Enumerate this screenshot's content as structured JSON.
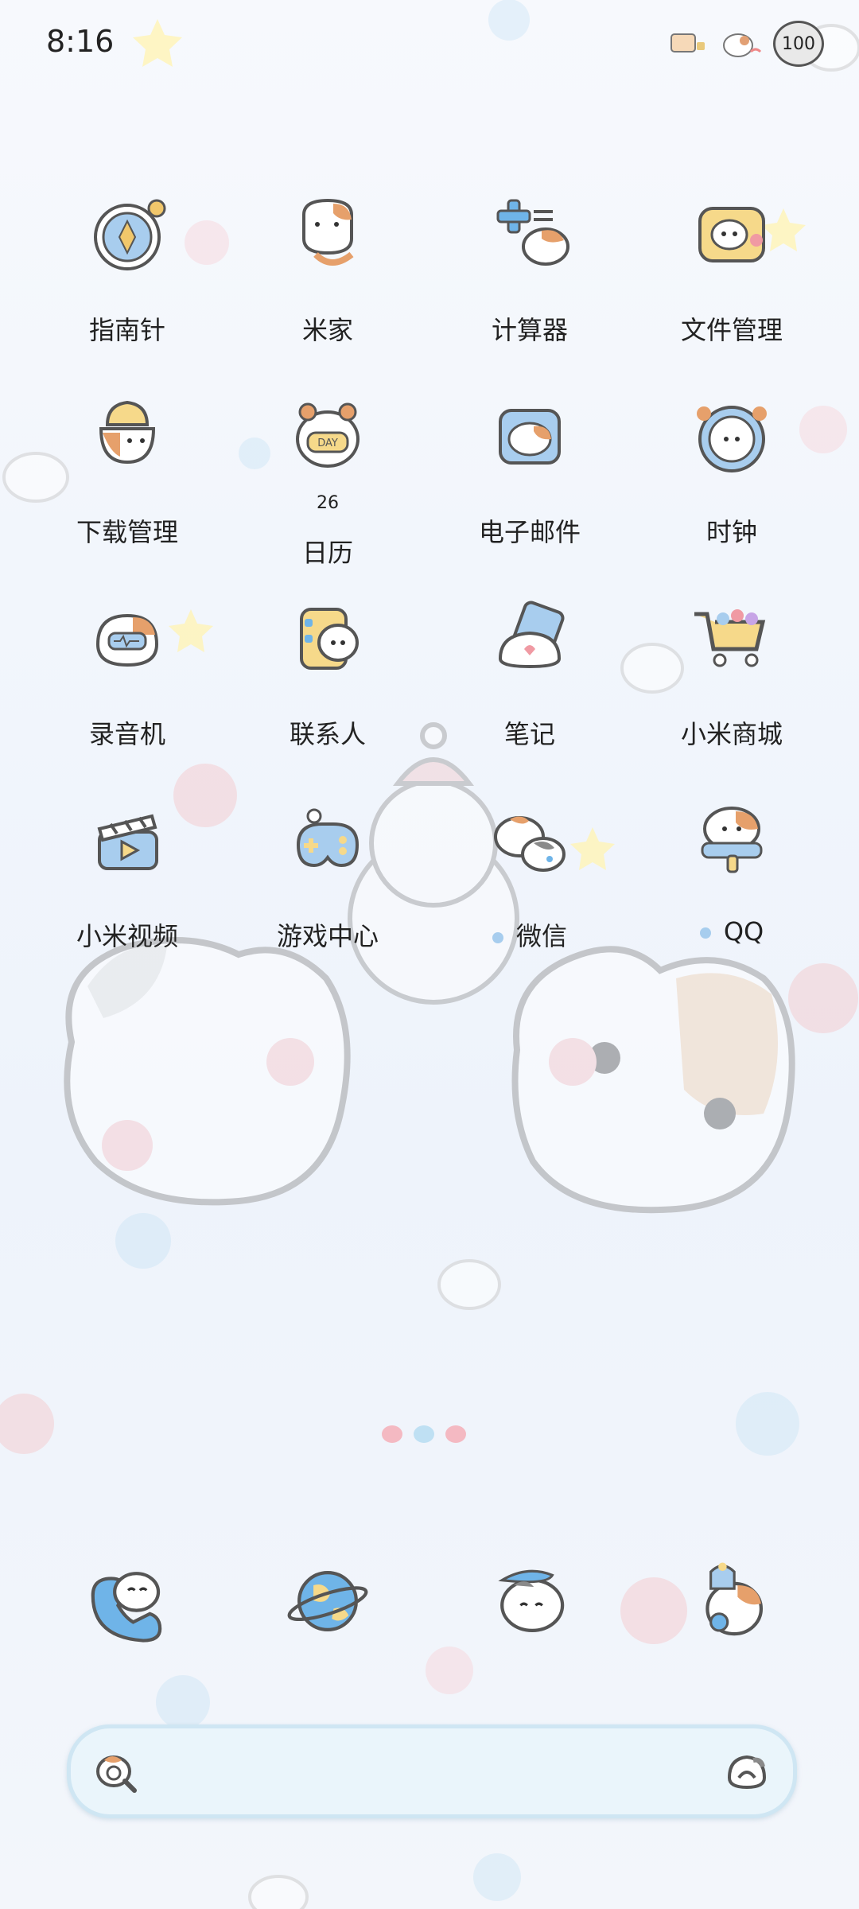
{
  "status_bar": {
    "time": "8:16",
    "battery": "100"
  },
  "apps": [
    [
      {
        "label": "指南针",
        "icon": "compass-icon"
      },
      {
        "label": "米家",
        "icon": "mihome-icon"
      },
      {
        "label": "计算器",
        "icon": "calculator-icon"
      },
      {
        "label": "文件管理",
        "icon": "file-manager-icon"
      }
    ],
    [
      {
        "label": "下载管理",
        "icon": "download-icon"
      },
      {
        "label": "日历",
        "icon": "calendar-icon",
        "date": "26"
      },
      {
        "label": "电子邮件",
        "icon": "email-icon"
      },
      {
        "label": "时钟",
        "icon": "clock-icon"
      }
    ],
    [
      {
        "label": "录音机",
        "icon": "recorder-icon"
      },
      {
        "label": "联系人",
        "icon": "contacts-icon"
      },
      {
        "label": "笔记",
        "icon": "notes-icon"
      },
      {
        "label": "小米商城",
        "icon": "mi-store-icon"
      }
    ],
    [
      {
        "label": "小米视频",
        "icon": "video-icon"
      },
      {
        "label": "游戏中心",
        "icon": "game-center-icon"
      },
      {
        "label": "微信",
        "icon": "wechat-icon"
      },
      {
        "label": "QQ",
        "icon": "qq-icon"
      }
    ]
  ],
  "dock": [
    {
      "icon": "phone-icon"
    },
    {
      "icon": "browser-icon"
    },
    {
      "icon": "messages-icon"
    },
    {
      "icon": "camera-icon"
    }
  ],
  "search": {
    "placeholder": ""
  }
}
